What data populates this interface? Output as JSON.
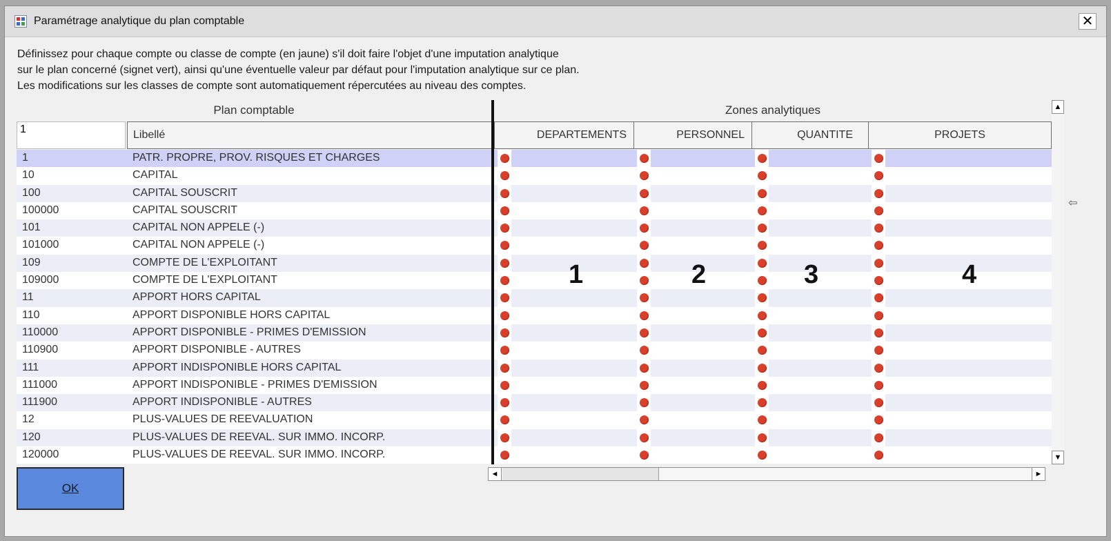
{
  "window": {
    "title": "Paramétrage analytique du plan comptable",
    "close_label": "✕"
  },
  "instructions": [
    "Définissez pour chaque compte ou classe de compte (en jaune) s'il doit faire l'objet d'une imputation analytique",
    "sur le plan concerné (signet vert), ainsi qu'une éventuelle valeur par défaut pour l'imputation analytique sur ce plan.",
    "Les modifications sur les classes de compte sont automatiquement répercutées au niveau des comptes."
  ],
  "grid": {
    "plan_header": "Plan comptable",
    "zones_header": "Zones analytiques",
    "filter_value": "1",
    "label_header": "Libellé",
    "zones": [
      {
        "name": "DEPARTEMENTS",
        "marker": "1"
      },
      {
        "name": "PERSONNEL",
        "marker": "2"
      },
      {
        "name": "QUANTITE",
        "marker": "3"
      },
      {
        "name": "PROJETS",
        "marker": "4"
      }
    ],
    "rows": [
      {
        "code": "1",
        "label": "PATR. PROPRE, PROV. RISQUES ET CHARGES"
      },
      {
        "code": "10",
        "label": "CAPITAL"
      },
      {
        "code": "100",
        "label": "CAPITAL SOUSCRIT"
      },
      {
        "code": "100000",
        "label": "CAPITAL SOUSCRIT"
      },
      {
        "code": "101",
        "label": "CAPITAL NON APPELE (-)"
      },
      {
        "code": "101000",
        "label": "CAPITAL NON APPELE (-)"
      },
      {
        "code": "109",
        "label": "COMPTE DE L'EXPLOITANT"
      },
      {
        "code": "109000",
        "label": "COMPTE DE L'EXPLOITANT"
      },
      {
        "code": "11",
        "label": "APPORT HORS CAPITAL"
      },
      {
        "code": "110",
        "label": "APPORT DISPONIBLE HORS CAPITAL"
      },
      {
        "code": "110000",
        "label": "APPORT DISPONIBLE - PRIMES D'EMISSION"
      },
      {
        "code": "110900",
        "label": "APPORT DISPONIBLE - AUTRES"
      },
      {
        "code": "111",
        "label": "APPORT INDISPONIBLE HORS CAPITAL"
      },
      {
        "code": "111000",
        "label": "APPORT INDISPONIBLE - PRIMES D'EMISSION"
      },
      {
        "code": "111900",
        "label": "APPORT INDISPONIBLE - AUTRES"
      },
      {
        "code": "12",
        "label": "PLUS-VALUES DE REEVALUATION"
      },
      {
        "code": "120",
        "label": "PLUS-VALUES DE REEVAL. SUR IMMO. INCORP."
      },
      {
        "code": "120000",
        "label": "PLUS-VALUES DE REEVAL. SUR IMMO. INCORP."
      }
    ],
    "selected_row": 0,
    "dot_color": "#d9402c",
    "selected_color": "#cfd1f6"
  },
  "scroll": {
    "up": "▲",
    "down": "▼",
    "left": "◄",
    "right": "►"
  },
  "edge_arrow": "⇦",
  "ok_button": "OK"
}
